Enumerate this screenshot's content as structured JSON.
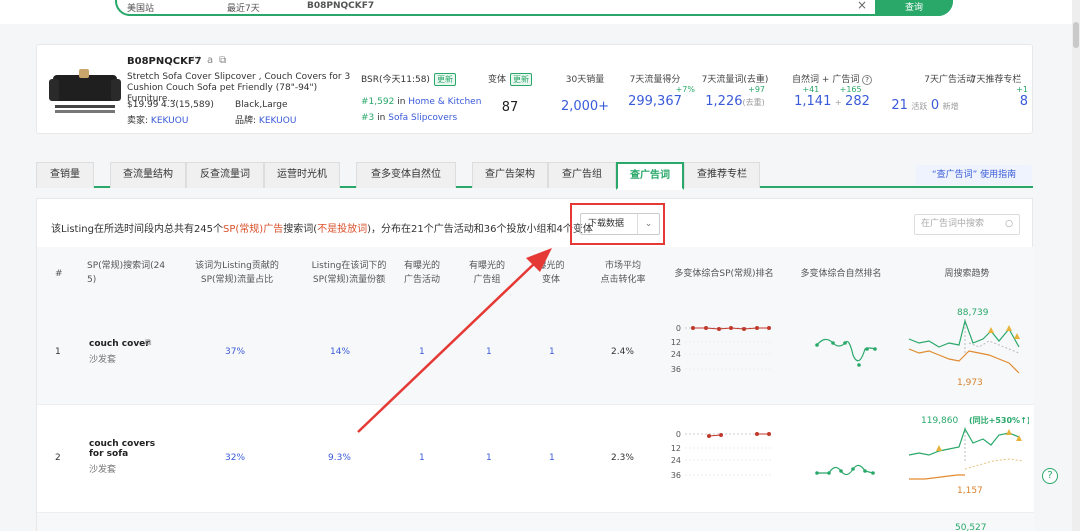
{
  "search": {
    "site": "美国站",
    "range": "最近7天",
    "keyword": "B08PNQCKF7",
    "clear_icon": "×",
    "button": "查询"
  },
  "product": {
    "asin": "B08PNQCKF7",
    "title": "Stretch Sofa Cover Slipcover , Couch Covers for 3 Cushion Couch Sofa pet Friendly (78\"-94\") Furniture...",
    "price": "$19.99",
    "rating": "4.3(15,589)",
    "seller_label": "卖家:",
    "seller": "KEKUOU",
    "variant": "Black,Large",
    "brand_label": "品牌:",
    "brand": "KEKUOU",
    "bsr_label": "BSR(今天11:58)",
    "update_tag": "更新",
    "rank1": "#1,592",
    "rank1_in": "in",
    "rank1_cat": "Home & Kitchen",
    "rank2": "#3",
    "rank2_in": "in",
    "rank2_cat": "Sofa Slipcovers"
  },
  "metrics": {
    "variants": {
      "label": "变体",
      "tag": "更新",
      "value": "87"
    },
    "sales30": {
      "label": "30天销量",
      "value": "2,000+"
    },
    "traffic_score": {
      "label": "7天流量得分",
      "delta": "+7%",
      "value": "299,367"
    },
    "traffic_words": {
      "label": "7天流量词(去重)",
      "delta": "+97",
      "value": "1,226",
      "sub": "(去重)"
    },
    "natural": {
      "label": "自然词",
      "delta": "+41",
      "value": "1,141",
      "plus": "+"
    },
    "ad_words": {
      "label": "广告词",
      "delta": "+165",
      "value": "282",
      "info_icon": "?"
    },
    "ad_campaign": {
      "label": "7天广告活动",
      "value_active": "21",
      "active_label": "活跃",
      "value_new": "0",
      "new_label": "新增"
    },
    "recommend": {
      "label": "7天推荐专栏",
      "delta": "+1",
      "value": "8"
    }
  },
  "tabs": [
    "查销量",
    "查流量结构",
    "反查流量词",
    "运营时光机",
    "查多变体自然位",
    "查广告架构",
    "查广告组",
    "查广告词",
    "查推荐专栏"
  ],
  "guide": "“查广告词” 使用指南",
  "summary": {
    "p1": "该Listing在所选时间段内总共有245个",
    "p2": "SP(常规)广告",
    "p3": "搜索词(",
    "p4": "不是投放词",
    "p5": ")，分布在21个广告活动和36个投放小组和4个变体"
  },
  "download": "下载数据",
  "table_search_placeholder": "在广告词中搜索",
  "headers": {
    "idx": "#",
    "kw1": "SP(常规)搜索词(24",
    "kw2": "5)",
    "share1": "该词为Listing贡献的",
    "share2": "SP(常规)流量占比",
    "part1": "Listing在该词下的",
    "part2": "SP(常规)流量份额",
    "camp1": "有曝光的",
    "camp2": "广告活动",
    "grp1": "有曝光的",
    "grp2": "广告组",
    "var1": "曝光的",
    "var2": "变体",
    "cvr1": "市场平均",
    "cvr2": "点击转化率",
    "sprank": "多变体综合SP(常规)排名",
    "natrank": "多变体综合自然排名",
    "trend": "周搜索趋势"
  },
  "rows": [
    {
      "idx": "1",
      "kw": "couch cover",
      "cn": "沙发套",
      "share": "37%",
      "part": "14%",
      "camp": "1",
      "grp": "1",
      "var": "1",
      "cvr": "2.4%",
      "trend_max": "88,739",
      "trend_min": "1,973",
      "trend_note": ""
    },
    {
      "idx": "2",
      "kw": "couch covers for sofa",
      "cn": "沙发套",
      "share": "32%",
      "part": "9.3%",
      "camp": "1",
      "grp": "1",
      "var": "1",
      "cvr": "2.3%",
      "trend_max": "119,860",
      "trend_min": "1,157",
      "trend_note": "(同比+530%↑)"
    },
    {
      "idx": "",
      "kw": "",
      "cn": "",
      "share": "",
      "part": "",
      "camp": "",
      "grp": "",
      "var": "",
      "cvr": "",
      "trend_max": "50,527",
      "trend_min": "",
      "trend_note": ""
    }
  ],
  "rank_ticks": [
    "0",
    "12",
    "24",
    "36"
  ],
  "help_icon": "?"
}
